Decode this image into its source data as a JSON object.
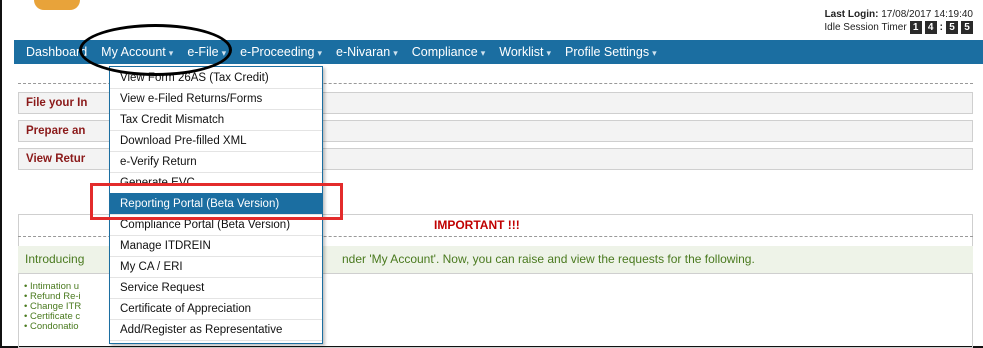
{
  "header": {
    "last_login_label": "Last Login:",
    "last_login_value": "17/08/2017 14:19:40",
    "idle_timer_label": "Idle Session Timer",
    "timer_digits": [
      "1",
      "4",
      "5",
      "5"
    ]
  },
  "navbar": {
    "items": [
      {
        "label": "Dashboard",
        "caret": ""
      },
      {
        "label": "My Account",
        "caret": "▾"
      },
      {
        "label": "e-File",
        "caret": "▾"
      },
      {
        "label": "e-Proceeding",
        "caret": "▾"
      },
      {
        "label": "e-Nivaran",
        "caret": "▾"
      },
      {
        "label": "Compliance",
        "caret": "▾"
      },
      {
        "label": "Worklist",
        "caret": "▾"
      },
      {
        "label": "Profile Settings",
        "caret": "▾"
      }
    ]
  },
  "panels": {
    "file_your": "File your In",
    "prepare": "Prepare an",
    "view_returns": "View Retur"
  },
  "dropdown": {
    "items": [
      "View Form 26AS (Tax Credit)",
      "View e-Filed Returns/Forms",
      "Tax Credit Mismatch",
      "Download Pre-filled XML",
      "e-Verify Return",
      "Generate EVC",
      "Reporting Portal (Beta Version)",
      "Compliance Portal (Beta Version)",
      "Manage ITDREIN",
      "My CA / ERI",
      "Service Request",
      "Certificate of Appreciation",
      "Add/Register as Representative"
    ],
    "active_index": 6
  },
  "important": {
    "title": "IMPORTANT !!!",
    "intro_left": "Introducing",
    "intro_right": "nder 'My Account'. Now, you can raise and view the requests for the following.",
    "bullets": [
      "Intimation u",
      "Refund Re-i",
      "Change ITR",
      "Certificate c",
      "Condonatio"
    ]
  },
  "colors": {
    "navbar": "#1b6ea1",
    "highlight_box": "#e32b2b",
    "important_title": "#c00000",
    "panel_label": "#8b1a1a",
    "intro_text": "#4a7a1f"
  }
}
